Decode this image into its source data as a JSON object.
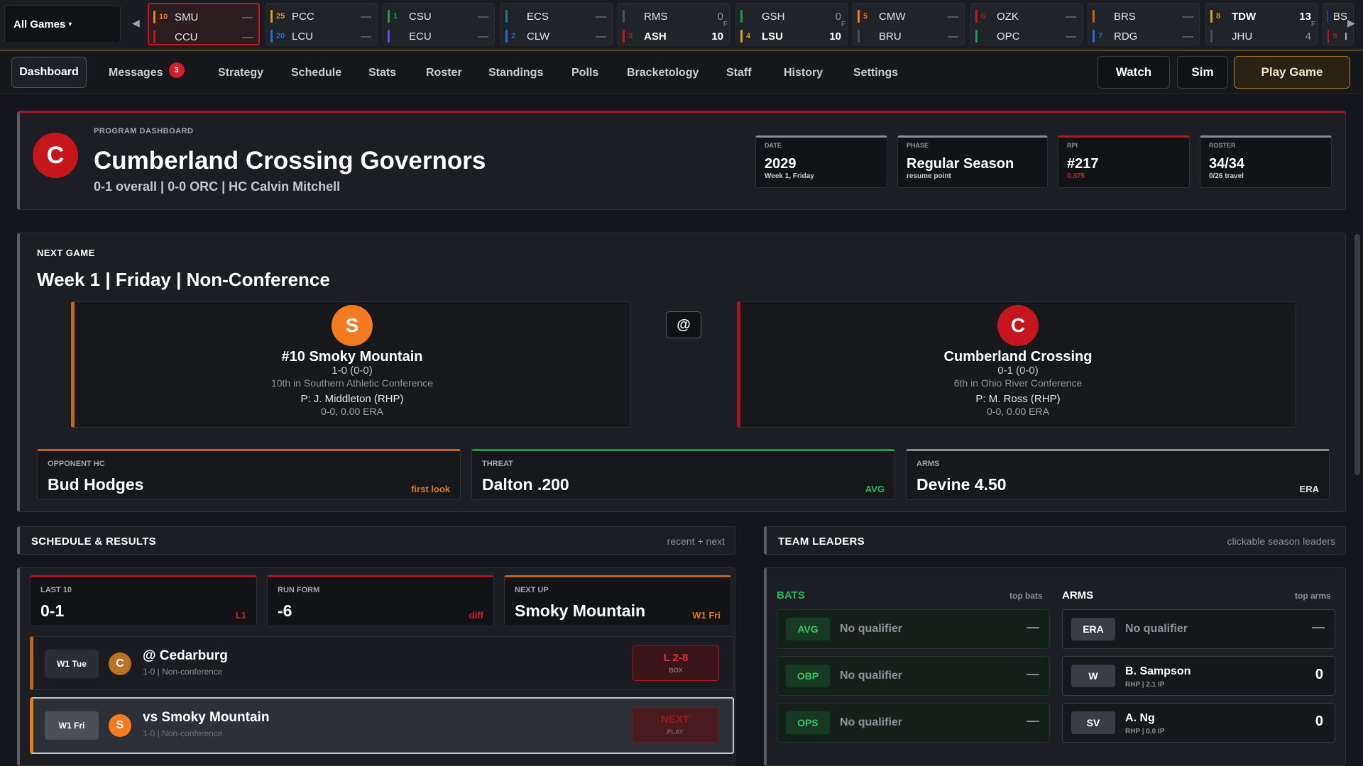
{
  "ticker": {
    "all_games": "All Games",
    "games": [
      {
        "t1": {
          "rank": "10",
          "abbr": "SMU",
          "score": "—",
          "color": "#f47b20"
        },
        "t2": {
          "rank": "",
          "abbr": "CCU",
          "score": "—",
          "color": "#c4161c"
        },
        "final": ""
      },
      {
        "t1": {
          "rank": "25",
          "abbr": "PCC",
          "score": "—",
          "color": "#d4a017"
        },
        "t2": {
          "rank": "20",
          "abbr": "LCU",
          "score": "—",
          "color": "#2a6ad4"
        },
        "final": ""
      },
      {
        "t1": {
          "rank": "1",
          "abbr": "CSU",
          "score": "—",
          "color": "#1d9a4a"
        },
        "t2": {
          "rank": "",
          "abbr": "ECU",
          "score": "—",
          "color": "#6a4ad4"
        },
        "final": ""
      },
      {
        "t1": {
          "rank": "",
          "abbr": "ECS",
          "score": "—",
          "color": "#1a7a8a"
        },
        "t2": {
          "rank": "2",
          "abbr": "CLW",
          "score": "—",
          "color": "#2a6ad4"
        },
        "final": ""
      },
      {
        "t1": {
          "rank": "",
          "abbr": "RMS",
          "score": "0",
          "color": "#4a4e57"
        },
        "t2": {
          "rank": "3",
          "abbr": "ASH",
          "score": "10",
          "color": "#c4161c"
        },
        "final": "F"
      },
      {
        "t1": {
          "rank": "",
          "abbr": "GSH",
          "score": "0",
          "color": "#1d9a4a"
        },
        "t2": {
          "rank": "4",
          "abbr": "LSU",
          "score": "10",
          "color": "#d4a017"
        },
        "final": "F"
      },
      {
        "t1": {
          "rank": "5",
          "abbr": "CMW",
          "score": "—",
          "color": "#f47b20"
        },
        "t2": {
          "rank": "",
          "abbr": "BRU",
          "score": "—",
          "color": "#4a4e57"
        },
        "final": ""
      },
      {
        "t1": {
          "rank": "6",
          "abbr": "OZK",
          "score": "—",
          "color": "#c4161c"
        },
        "t2": {
          "rank": "",
          "abbr": "OPC",
          "score": "—",
          "color": "#1d9a4a"
        },
        "final": ""
      },
      {
        "t1": {
          "rank": "",
          "abbr": "BRS",
          "score": "—",
          "color": "#c0661a"
        },
        "t2": {
          "rank": "7",
          "abbr": "RDG",
          "score": "—",
          "color": "#2a6ad4"
        },
        "final": ""
      },
      {
        "t1": {
          "rank": "8",
          "abbr": "TDW",
          "score": "13",
          "color": "#d4a017"
        },
        "t2": {
          "rank": "",
          "abbr": "JHU",
          "score": "4",
          "color": "#4a4e57"
        },
        "final": "F"
      },
      {
        "t1": {
          "rank": "",
          "abbr": "BS",
          "score": "",
          "color": "#2a6ad4"
        },
        "t2": {
          "rank": "9",
          "abbr": "I",
          "score": "",
          "color": "#c4161c"
        },
        "final": ""
      }
    ]
  },
  "nav": {
    "items": [
      "Dashboard",
      "Messages",
      "Strategy",
      "Schedule",
      "Stats",
      "Roster",
      "Standings",
      "Polls",
      "Bracketology",
      "Staff",
      "History",
      "Settings"
    ],
    "messages_badge": "3",
    "watch": "Watch",
    "sim": "Sim",
    "play_game": "Play Game"
  },
  "header": {
    "eyebrow": "PROGRAM DASHBOARD",
    "logo_letter": "C",
    "title": "Cumberland Crossing Governors",
    "subtitle": "0-1 overall | 0-0 ORC | HC Calvin Mitchell",
    "cards": [
      {
        "label": "DATE",
        "value": "2029",
        "sub": "Week 1, Friday"
      },
      {
        "label": "PHASE",
        "value": "Regular Season",
        "sub": "resume point"
      },
      {
        "label": "RPI",
        "value": "#217",
        "sub": "0.375"
      },
      {
        "label": "ROSTER",
        "value": "34/34",
        "sub": "0/26 travel"
      }
    ]
  },
  "next_game": {
    "eyebrow": "NEXT GAME",
    "title": "Week 1  |  Friday  |  Non-Conference",
    "at": "@",
    "away": {
      "logo": "S",
      "name": "#10 Smoky Mountain",
      "record": "1-0  (0-0)",
      "conf": "10th in Southern Athletic Conference",
      "pitcher": "P: J. Middleton (RHP)",
      "era": "0-0, 0.00 ERA"
    },
    "home": {
      "logo": "C",
      "name": "Cumberland Crossing",
      "record": "0-1  (0-0)",
      "conf": "6th in Ohio River Conference",
      "pitcher": "P: M. Ross (RHP)",
      "era": "0-0, 0.00 ERA"
    },
    "cards": [
      {
        "label": "OPPONENT HC",
        "value": "Bud Hodges",
        "tag": "first look"
      },
      {
        "label": "THREAT",
        "value": "Dalton .200",
        "tag": "AVG"
      },
      {
        "label": "ARMS",
        "value": "Devine 4.50",
        "tag": "ERA"
      }
    ]
  },
  "schedule": {
    "title": "SCHEDULE & RESULTS",
    "right": "recent + next",
    "cards": [
      {
        "label": "LAST 10",
        "value": "0-1",
        "tag": "L1"
      },
      {
        "label": "RUN FORM",
        "value": "-6",
        "tag": "diff"
      },
      {
        "label": "NEXT UP",
        "value": "Smoky Mountain",
        "tag": "W1 Fri"
      }
    ],
    "games": [
      {
        "day": "W1 Tue",
        "logo": "C",
        "opp": "@ Cedarburg",
        "info": "1-0 | Non-conference",
        "result": "L 2-8",
        "result_sub": "BOX"
      },
      {
        "day": "W1 Fri",
        "logo": "S",
        "opp": "vs Smoky Mountain",
        "info": "1-0 | Non-conference",
        "result": "NEXT",
        "result_sub": "PLAY"
      }
    ]
  },
  "leaders": {
    "title": "TEAM LEADERS",
    "right": "clickable season leaders",
    "bats_title": "BATS",
    "bats_sub": "top bats",
    "arms_title": "ARMS",
    "arms_sub": "top arms",
    "bats": [
      {
        "stat": "AVG",
        "text": "No qualifier",
        "value": "—"
      },
      {
        "stat": "OBP",
        "text": "No qualifier",
        "value": "—"
      },
      {
        "stat": "OPS",
        "text": "No qualifier",
        "value": "—"
      }
    ],
    "arms": [
      {
        "stat": "ERA",
        "text": "No qualifier",
        "value": "—"
      },
      {
        "stat": "W",
        "name": "B. Sampson",
        "info": "RHP | 2.1 IP",
        "value": "0"
      },
      {
        "stat": "SV",
        "name": "A. Ng",
        "info": "RHP | 0.0 IP",
        "value": "0"
      }
    ]
  }
}
